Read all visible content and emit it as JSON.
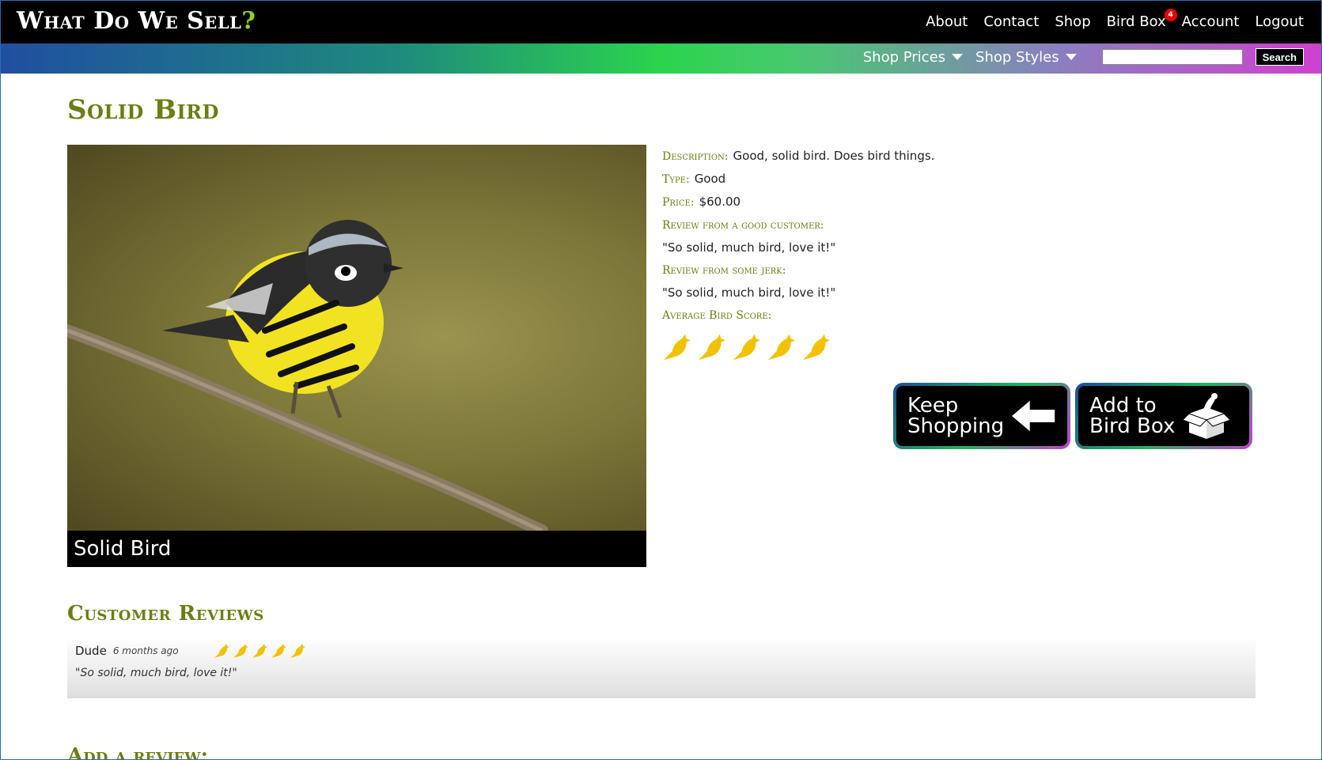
{
  "header": {
    "logo_text": "What Do We Sell",
    "logo_mark": "?",
    "nav": [
      {
        "label": "About"
      },
      {
        "label": "Contact"
      },
      {
        "label": "Shop"
      },
      {
        "label": "Bird Box",
        "badge": "4"
      },
      {
        "label": "Account"
      },
      {
        "label": "Logout"
      }
    ]
  },
  "subnav": {
    "prices_label": "Shop Prices",
    "styles_label": "Shop Styles",
    "search_value": "",
    "search_button": "Search"
  },
  "product": {
    "title": "Solid Bird",
    "image_caption": "Solid Bird",
    "description_label": "Description:",
    "description": "Good, solid bird. Does bird things.",
    "type_label": "Type:",
    "type": "Good",
    "price_label": "Price:",
    "price": "$60.00",
    "good_review_label": "Review from a good customer:",
    "good_review": "\"So solid, much bird, love it!\"",
    "jerk_review_label": "Review from some jerk:",
    "jerk_review": "\"So solid, much bird, love it!\"",
    "avg_score_label": "Average Bird Score:",
    "avg_score": 5,
    "max_score": 5
  },
  "actions": {
    "keep_line1": "Keep",
    "keep_line2": "Shopping",
    "add_line1": "Add to",
    "add_line2": "Bird Box"
  },
  "reviews": {
    "heading": "Customer Reviews",
    "items": [
      {
        "author": "Dude",
        "ago": "6 months ago",
        "score": 5,
        "text": "\"So solid, much bird, love it!\""
      }
    ]
  },
  "add_review": {
    "heading": "Add a review:"
  },
  "colors": {
    "accent": "#6d7d12",
    "star": "#f2c200",
    "badge": "#e00000"
  }
}
